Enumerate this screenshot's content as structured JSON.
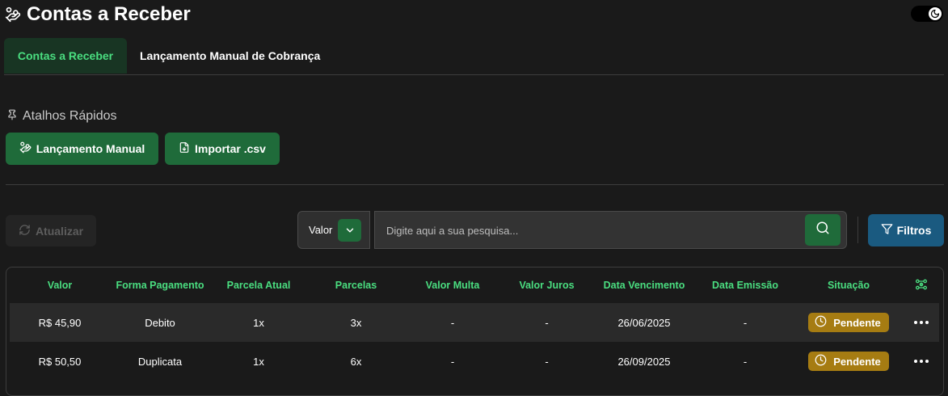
{
  "header": {
    "title": "Contas a Receber",
    "logo_icon": "hand-coins-icon",
    "theme_toggle_icon": "moon-icon"
  },
  "tabs": [
    {
      "label": "Contas a Receber",
      "active": true
    },
    {
      "label": "Lançamento Manual de Cobrança",
      "active": false
    }
  ],
  "shortcuts": {
    "title": "Atalhos Rápidos",
    "icon": "pin-icon",
    "manual_label": "Lançamento Manual",
    "import_label": "Importar .csv"
  },
  "toolbar": {
    "refresh_label": "Atualizar",
    "search_field_selected": "Valor",
    "search_placeholder": "Digite aqui a sua pesquisa...",
    "filter_label": "Filtros"
  },
  "table": {
    "columns": [
      "Valor",
      "Forma Pagamento",
      "Parcela Atual",
      "Parcelas",
      "Valor Multa",
      "Valor Juros",
      "Data Vencimento",
      "Data Emissão",
      "Situação"
    ],
    "rows": [
      {
        "valor": "R$ 45,90",
        "forma": "Debito",
        "parcela_atual": "1x",
        "parcelas": "3x",
        "multa": "-",
        "juros": "-",
        "vencimento": "26/06/2025",
        "emissao": "-",
        "situacao": "Pendente"
      },
      {
        "valor": "R$ 50,50",
        "forma": "Duplicata",
        "parcela_atual": "1x",
        "parcelas": "6x",
        "multa": "-",
        "juros": "-",
        "vencimento": "26/09/2025",
        "emissao": "-",
        "situacao": "Pendente"
      }
    ]
  },
  "colors": {
    "accent_green": "#4ade80",
    "button_green": "#1f6b3a",
    "filter_blue": "#1a5a80",
    "status_pending": "#a67c12"
  }
}
